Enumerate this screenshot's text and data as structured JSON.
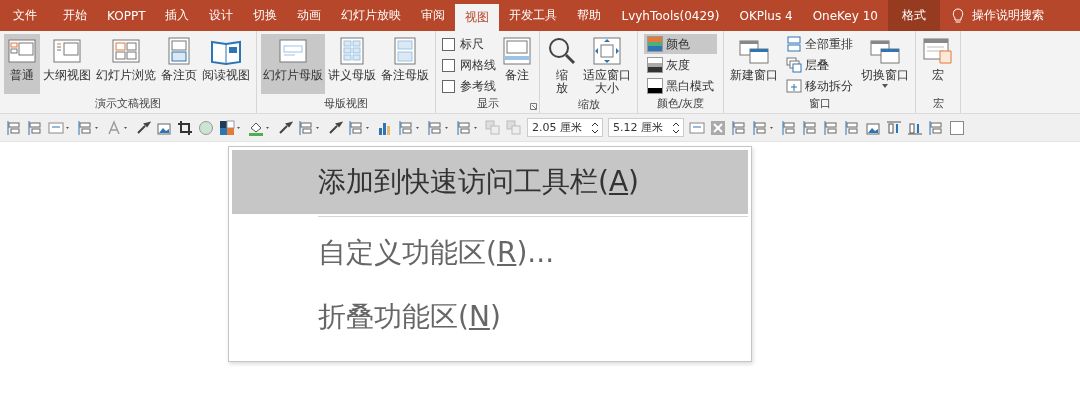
{
  "tabs": [
    {
      "label": "文件",
      "selected": false,
      "kind": "normal"
    },
    {
      "label": "开始",
      "selected": false,
      "kind": "normal"
    },
    {
      "label": "KOPPT",
      "selected": false,
      "kind": "normal"
    },
    {
      "label": "插入",
      "selected": false,
      "kind": "normal"
    },
    {
      "label": "设计",
      "selected": false,
      "kind": "normal"
    },
    {
      "label": "切换",
      "selected": false,
      "kind": "normal"
    },
    {
      "label": "动画",
      "selected": false,
      "kind": "normal"
    },
    {
      "label": "幻灯片放映",
      "selected": false,
      "kind": "normal"
    },
    {
      "label": "审阅",
      "selected": false,
      "kind": "normal"
    },
    {
      "label": "视图",
      "selected": true,
      "kind": "normal"
    },
    {
      "label": "开发工具",
      "selected": false,
      "kind": "normal"
    },
    {
      "label": "帮助",
      "selected": false,
      "kind": "normal"
    },
    {
      "label": "LvyhTools(0429)",
      "selected": false,
      "kind": "normal"
    },
    {
      "label": "OKPlus 4",
      "selected": false,
      "kind": "normal"
    },
    {
      "label": "OneKey 10",
      "selected": false,
      "kind": "normal"
    },
    {
      "label": "格式",
      "selected": false,
      "kind": "contextual"
    }
  ],
  "search": {
    "placeholder": "操作说明搜索"
  },
  "ribbon_groups": [
    {
      "label": "演示文稿视图",
      "items": [
        {
          "kind": "large",
          "label": "普通",
          "selected": true
        },
        {
          "kind": "large",
          "label": "大纲视图",
          "selected": false
        },
        {
          "kind": "large",
          "label": "幻灯片浏览",
          "selected": false
        },
        {
          "kind": "large",
          "label": "备注页",
          "selected": false
        },
        {
          "kind": "large",
          "label": "阅读视图",
          "selected": false
        }
      ]
    },
    {
      "label": "母版视图",
      "items": [
        {
          "kind": "large",
          "label": "幻灯片母版",
          "selected": true
        },
        {
          "kind": "large",
          "label": "讲义母版",
          "selected": false
        },
        {
          "kind": "large",
          "label": "备注母版",
          "selected": false
        }
      ]
    },
    {
      "label": "显示",
      "launcher": true,
      "items": [
        {
          "kind": "stack",
          "items": [
            {
              "kind": "checkbox",
              "label": "标尺",
              "checked": false
            },
            {
              "kind": "checkbox",
              "label": "网格线",
              "checked": false
            },
            {
              "kind": "checkbox",
              "label": "参考线",
              "checked": false
            }
          ]
        },
        {
          "kind": "large",
          "label": "备注",
          "selected": false
        }
      ]
    },
    {
      "label": "缩放",
      "items": [
        {
          "kind": "large",
          "label": "缩放",
          "selected": false,
          "narrow": true
        },
        {
          "kind": "large",
          "label": "适应窗口大小",
          "selected": false,
          "narrow": false
        }
      ]
    },
    {
      "label": "颜色/灰度",
      "items": [
        {
          "kind": "stack",
          "items": [
            {
              "kind": "small",
              "label": "颜色",
              "selected": true
            },
            {
              "kind": "small",
              "label": "灰度",
              "selected": false
            },
            {
              "kind": "small",
              "label": "黑白模式",
              "selected": false
            }
          ]
        }
      ]
    },
    {
      "label": "窗口",
      "items": [
        {
          "kind": "large",
          "label": "新建窗口",
          "selected": false
        },
        {
          "kind": "stack",
          "items": [
            {
              "kind": "small",
              "label": "全部重排",
              "selected": false
            },
            {
              "kind": "small",
              "label": "层叠",
              "selected": false
            },
            {
              "kind": "small",
              "label": "移动拆分",
              "selected": false
            }
          ]
        },
        {
          "kind": "large",
          "label": "切换窗口",
          "selected": false,
          "dropdown": true
        }
      ]
    },
    {
      "label": "宏",
      "items": [
        {
          "kind": "large",
          "label": "宏",
          "selected": false
        }
      ]
    }
  ],
  "toolbar": {
    "size_fields": [
      {
        "value": "2.05 厘米"
      },
      {
        "value": "5.12 厘米"
      }
    ]
  },
  "context_menu": {
    "items": [
      {
        "before": "添加到快速访问工具栏(",
        "key": "A",
        "after": ")",
        "selected": true,
        "separator_after": true
      },
      {
        "before": "自定义功能区(",
        "key": "R",
        "after": ")...",
        "selected": false,
        "separator_after": false
      },
      {
        "before": "折叠功能区(",
        "key": "N",
        "after": ")",
        "selected": false,
        "separator_after": false
      }
    ]
  }
}
